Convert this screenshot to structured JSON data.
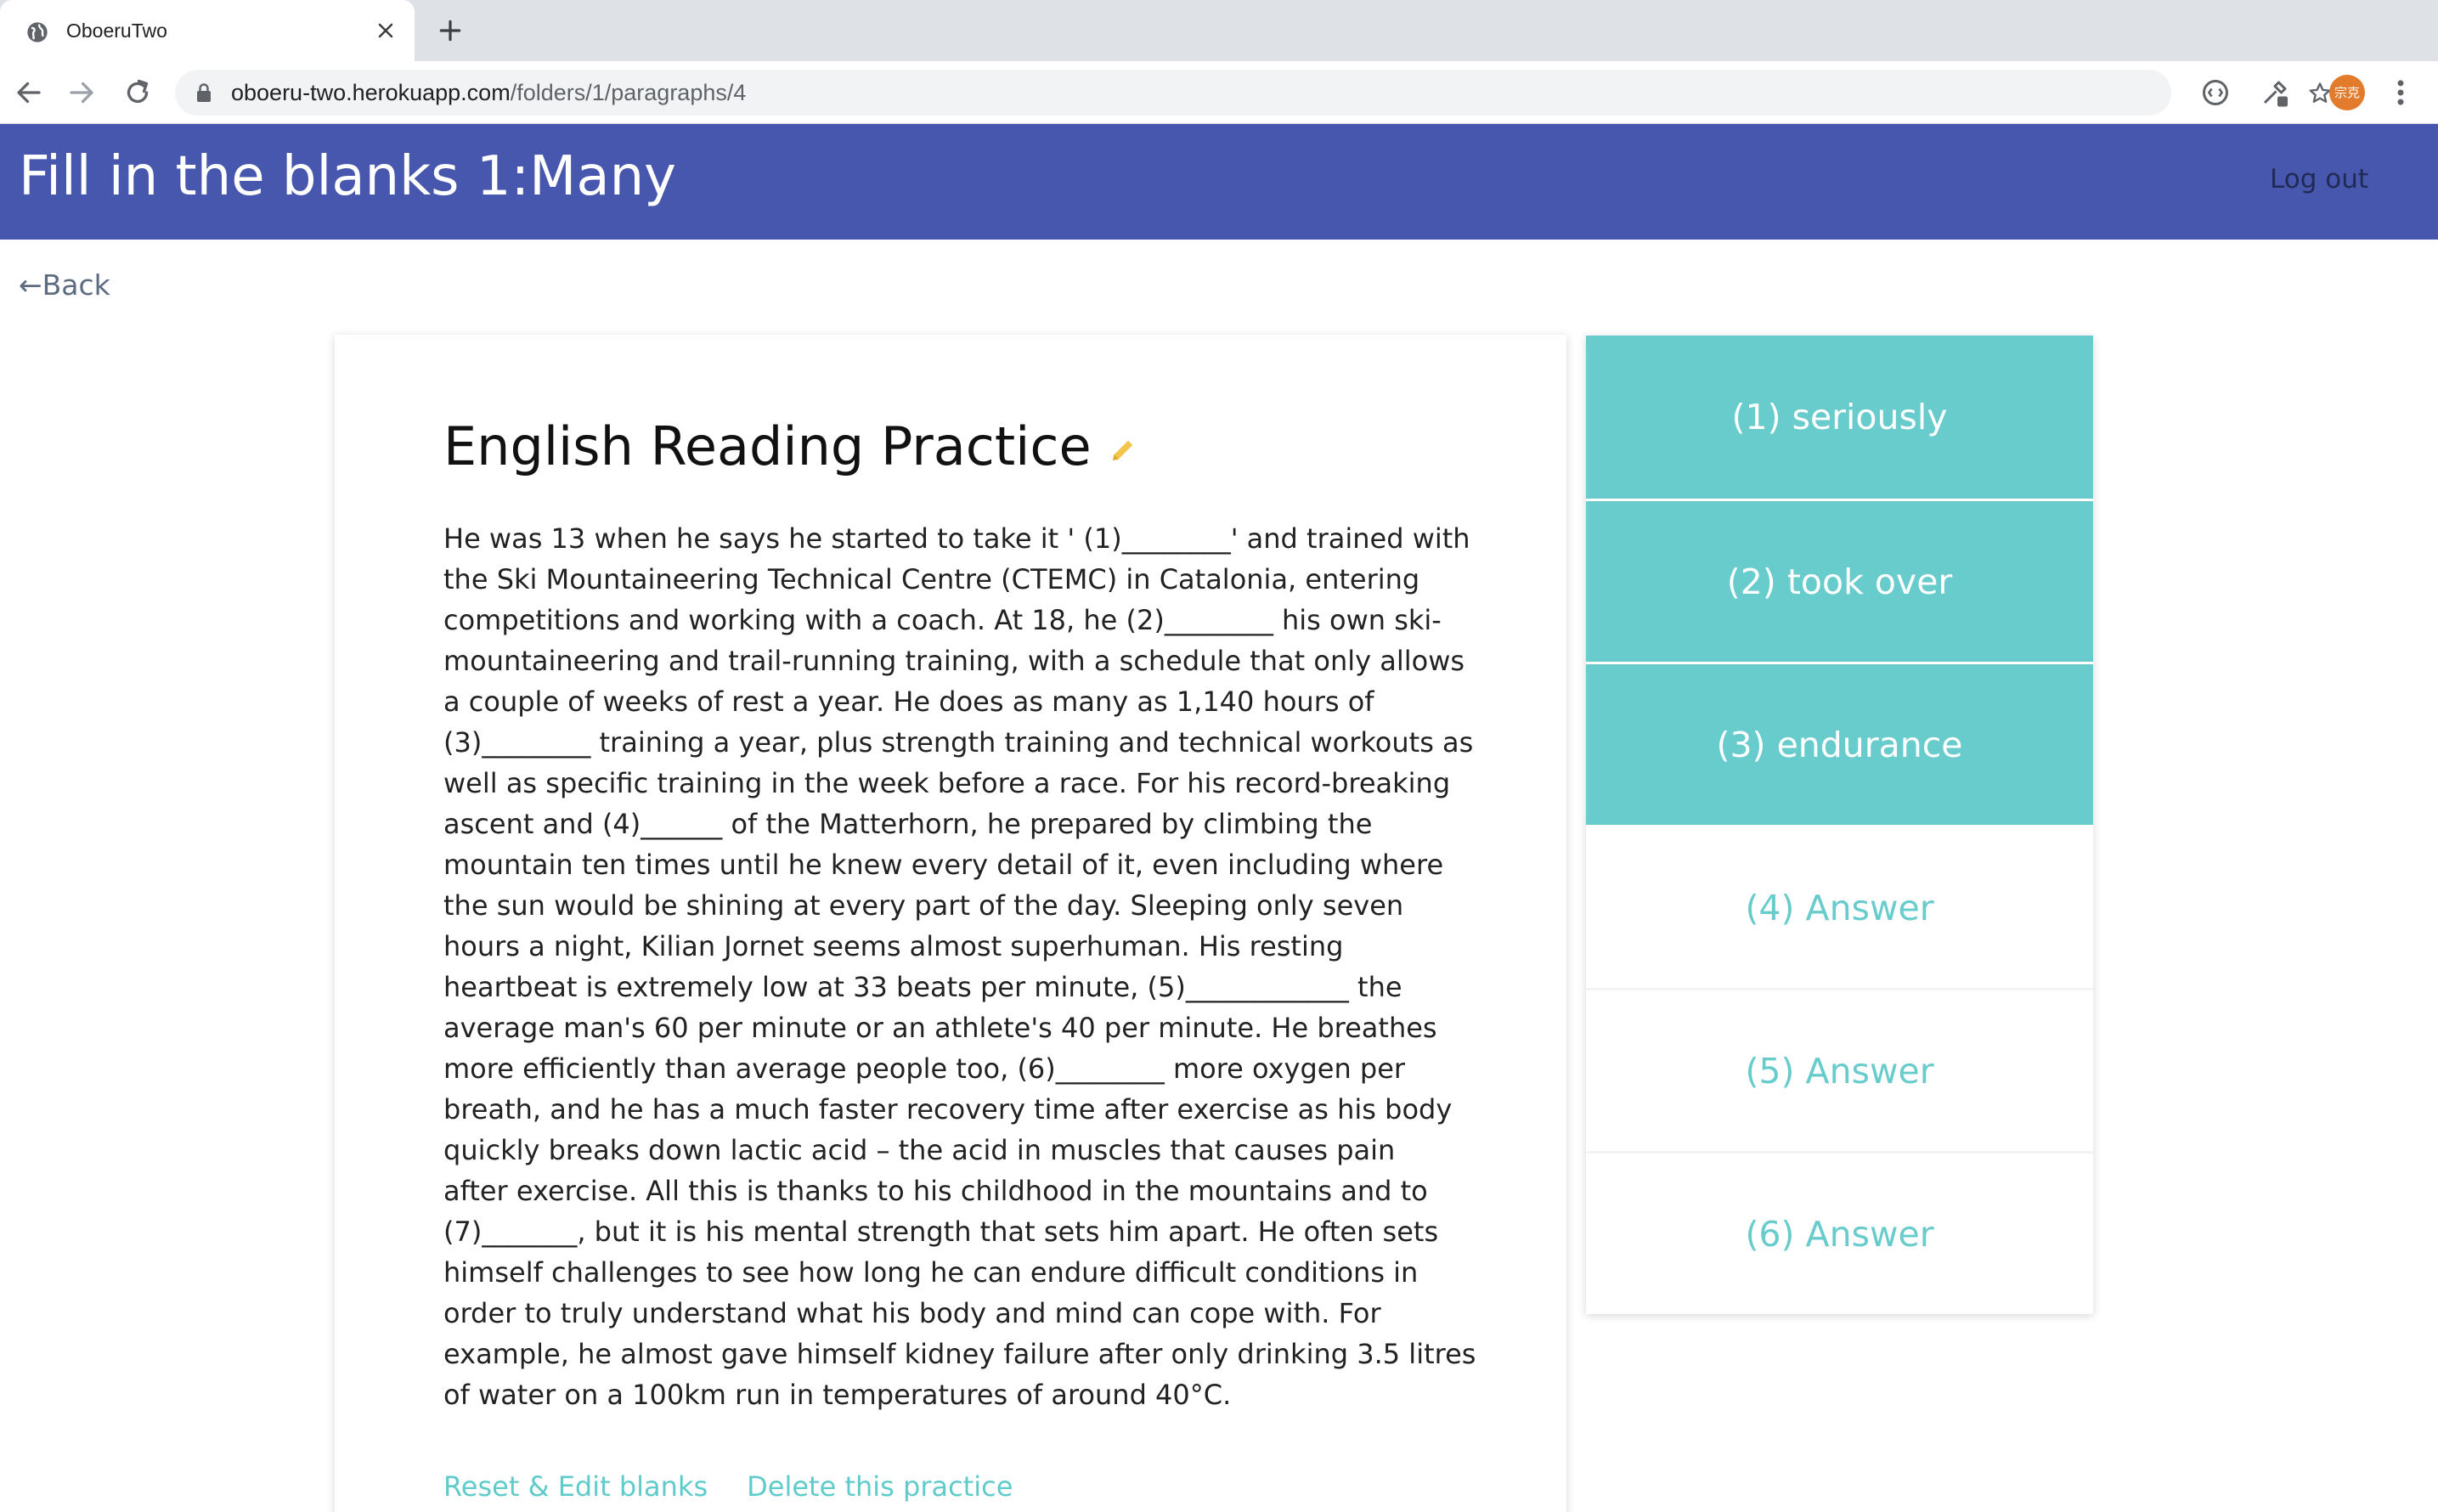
{
  "browser": {
    "tab_title": "OboeruTwo",
    "url_host": "oboeru-two.herokuapp.com",
    "url_path": "/folders/1/paragraphs/4",
    "avatar_text": "宗克"
  },
  "header": {
    "title": "Fill in the blanks 1:Many",
    "logout_label": "Log out"
  },
  "nav": {
    "back_label": "←Back"
  },
  "card": {
    "title": "English Reading Practice",
    "passage_lines": [
      "He was 13 when he says he started to take it ' (1)________' and trained with",
      "the Ski Mountaineering Technical Centre (CTEMC) in Catalonia, entering",
      "competitions and working with a coach. At 18, he (2)________ his own ski-",
      "mountaineering and trail-running training, with a schedule that only allows",
      "a couple of weeks of rest a year. He does as many as 1,140 hours of",
      "(3)________ training a year, plus strength training and technical workouts as",
      "well as specific training in the week before a race. For his record-breaking",
      "ascent and (4)______ of the Matterhorn, he prepared by climbing the",
      "mountain ten times until he knew every detail of it, even including where",
      "the sun would be shining at every part of the day. Sleeping only seven",
      "hours a night, Kilian Jornet seems almost superhuman. His resting",
      "heartbeat is extremely low at 33 beats per minute, (5)____________ the",
      "average man's 60 per minute or an athlete's 40 per minute. He breathes",
      "more efficiently than average people too, (6)________ more oxygen per",
      "breath, and he has a much faster recovery time after exercise as his body",
      "quickly breaks down lactic acid – the acid in muscles that causes pain",
      "after exercise. All this is thanks to his childhood in the mountains and to",
      "(7)_______, but it is his mental strength that sets him apart. He often sets",
      "himself challenges to see how long he can endure difficult conditions in",
      "order to truly understand what his body and mind can cope with. For",
      "example, he almost gave himself kidney failure after only drinking 3.5 litres",
      "of water on a 100km run in temperatures of around 40°C."
    ],
    "reset_label": "Reset & Edit blanks",
    "delete_label": "Delete this practice"
  },
  "answers": [
    {
      "label": "(1) seriously",
      "state": "revealed"
    },
    {
      "label": "(2) took over",
      "state": "revealed"
    },
    {
      "label": "(3) endurance",
      "state": "revealed"
    },
    {
      "label": "(4) Answer",
      "state": "hidden"
    },
    {
      "label": "(5) Answer",
      "state": "hidden"
    },
    {
      "label": "(6) Answer",
      "state": "hidden"
    }
  ],
  "colors": {
    "header_bg": "#4657ad",
    "accent_teal": "#68cbcc",
    "pencil": "#f3c64b"
  },
  "icons": [
    "globe-icon",
    "close-icon",
    "plus-icon",
    "back-arrow-icon",
    "forward-arrow-icon",
    "reload-icon",
    "lock-icon",
    "star-icon",
    "extension-icon",
    "eyedropper-icon",
    "menu-icon",
    "pencil-icon"
  ]
}
